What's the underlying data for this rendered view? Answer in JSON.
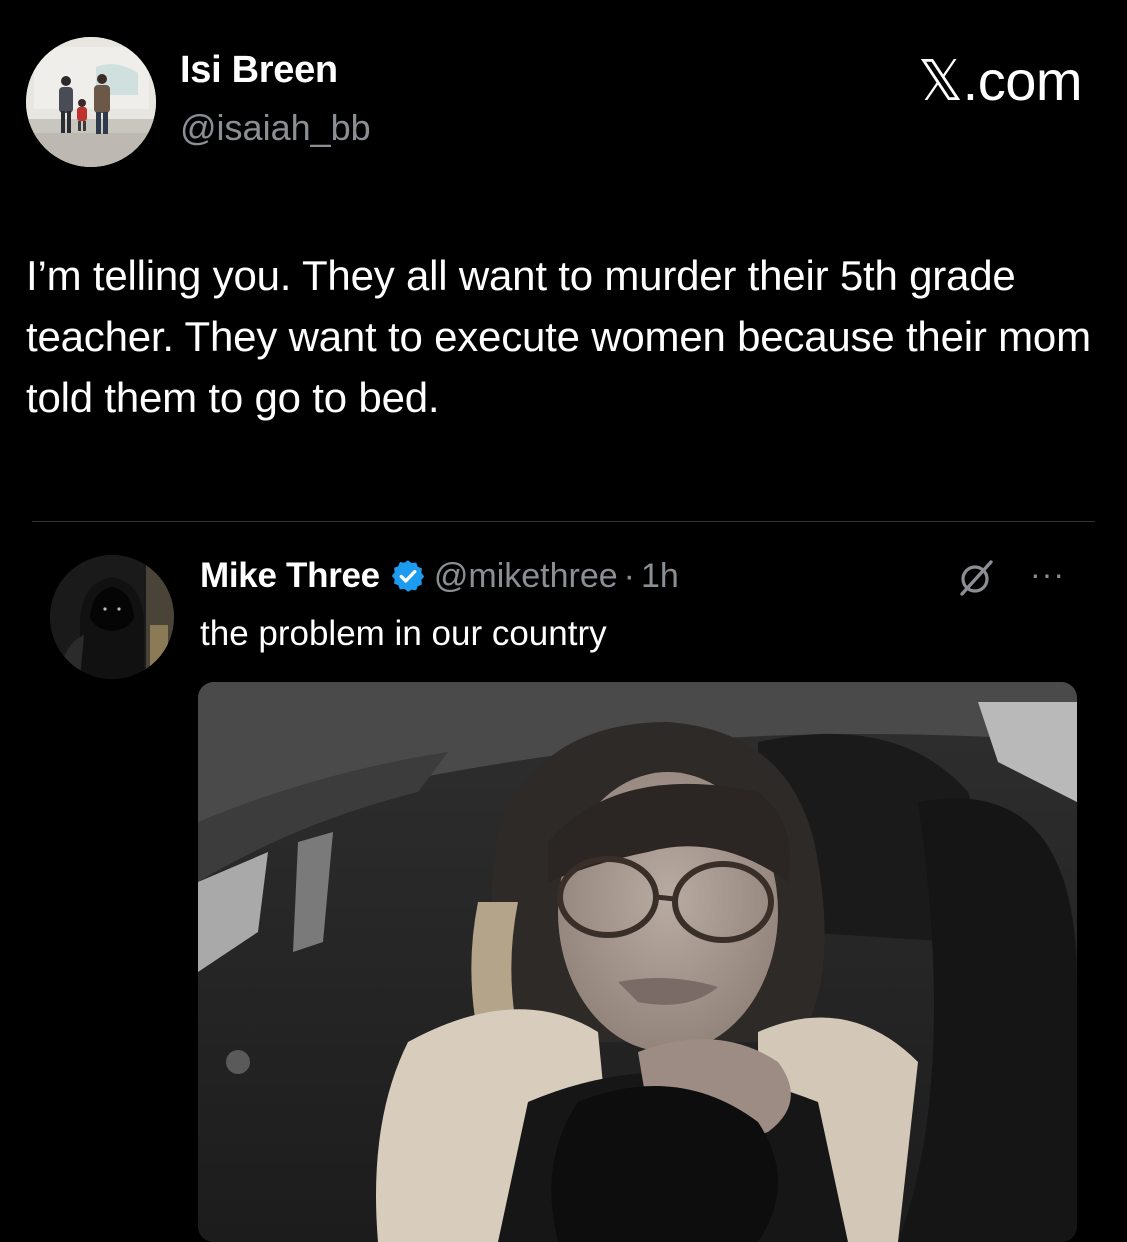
{
  "author": {
    "name": "Isi Breen",
    "handle": "@isaiah_bb"
  },
  "brand": "𝕏.com",
  "tweet": {
    "text": "I’m telling you. They all want to murder their 5th grade teacher. They want to execute women because their mom told them to go to bed."
  },
  "quoted_tweet": {
    "name": "Mike Three",
    "handle": "@mikethree",
    "separator": "·",
    "time": "1h",
    "text": "the problem in our country",
    "verified_color": "#1d9bf0"
  },
  "icons": {
    "verified": "verified-badge-icon",
    "grok": "grok-icon",
    "more": "more-options-icon"
  },
  "more_glyph": "···"
}
